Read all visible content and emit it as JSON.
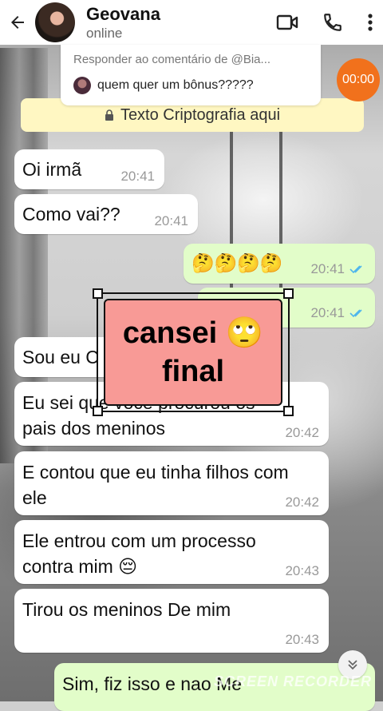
{
  "header": {
    "name": "Geovana",
    "status": "online",
    "icons": [
      "back-arrow-icon",
      "video-call-icon",
      "phone-icon",
      "more-options-icon"
    ]
  },
  "reply_banner": {
    "title": "Responder ao comentário de @Bia...",
    "comment": "quem quer um bônus?????"
  },
  "timer": {
    "value": "00:00"
  },
  "crypto_notice": {
    "text": "Texto Criptografia aqui",
    "icon": "lock-icon"
  },
  "messages": [
    {
      "dir": "in",
      "text": "Oi irmã",
      "time": "20:41"
    },
    {
      "dir": "in",
      "text": "Como vai??",
      "time": "20:41"
    },
    {
      "dir": "out",
      "text": "🤔🤔🤔🤔",
      "time": "20:41",
      "ticks": "read"
    },
    {
      "dir": "out",
      "text": "",
      "time": "20:41",
      "ticks": "read"
    },
    {
      "dir": "in",
      "text": "Sou eu C",
      "time": ""
    },
    {
      "dir": "in",
      "text": "Eu sei que você procurou os pais dos meninos",
      "time": "20:42"
    },
    {
      "dir": "in",
      "text": "E contou que eu tinha filhos com ele",
      "time": "20:42"
    },
    {
      "dir": "in",
      "text": "Ele entrou com um processo contra mim 😔",
      "time": "20:43"
    },
    {
      "dir": "in",
      "text": "Tirou os meninos De mim",
      "time": "20:43"
    },
    {
      "dir": "out",
      "text": "Sim, fiz isso e nao Me",
      "time": ""
    }
  ],
  "sticker": {
    "line1": "cansei 🙄",
    "line2": "final"
  },
  "watermark": "SCREEN RECORDER",
  "colors": {
    "incoming": "#ffffff",
    "outgoing": "#e2fdc9",
    "timer": "#f1711c",
    "crypto_bg": "#fff7c2",
    "read_ticks": "#4fb6ec",
    "sticker_bg": "#f89a96"
  }
}
